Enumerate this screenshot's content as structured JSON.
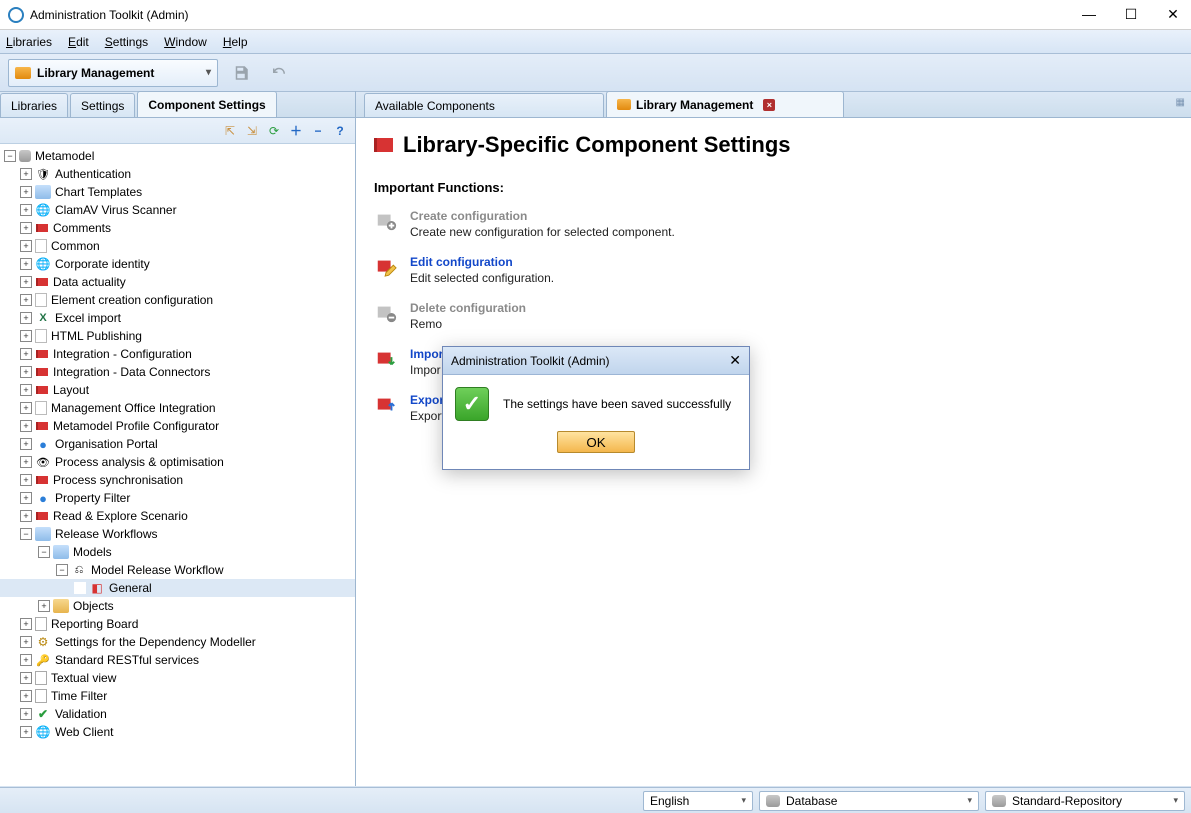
{
  "window": {
    "title": "Administration Toolkit (Admin)"
  },
  "menubar": {
    "items": [
      "Libraries",
      "Edit",
      "Settings",
      "Window",
      "Help"
    ]
  },
  "toolbar": {
    "library_dropdown": "Library Management"
  },
  "left_tabs": {
    "items": [
      "Libraries",
      "Settings",
      "Component Settings"
    ],
    "active_index": 2
  },
  "right_tabs": {
    "items": [
      {
        "label": "Available Components",
        "closable": false,
        "icon": false
      },
      {
        "label": "Library Management",
        "closable": true,
        "icon": true
      }
    ]
  },
  "tree": {
    "root": "Metamodel",
    "items": [
      {
        "label": "Authentication",
        "icon": "shield",
        "expand": "+"
      },
      {
        "label": "Chart Templates",
        "icon": "folder-open",
        "expand": "+"
      },
      {
        "label": "ClamAV Virus Scanner",
        "icon": "globe",
        "expand": "+"
      },
      {
        "label": "Comments",
        "icon": "flag",
        "expand": "+"
      },
      {
        "label": "Common",
        "icon": "page",
        "expand": "+"
      },
      {
        "label": "Corporate identity",
        "icon": "globe",
        "expand": "+"
      },
      {
        "label": "Data actuality",
        "icon": "flag",
        "expand": "+"
      },
      {
        "label": "Element creation configuration",
        "icon": "page",
        "expand": "+"
      },
      {
        "label": "Excel import",
        "icon": "excel",
        "expand": "+"
      },
      {
        "label": "HTML Publishing",
        "icon": "page",
        "expand": "+"
      },
      {
        "label": "Integration - Configuration",
        "icon": "flag",
        "expand": "+"
      },
      {
        "label": "Integration - Data Connectors",
        "icon": "flag",
        "expand": "+"
      },
      {
        "label": "Layout",
        "icon": "flag",
        "expand": "+"
      },
      {
        "label": "Management Office Integration",
        "icon": "page",
        "expand": "+"
      },
      {
        "label": "Metamodel Profile Configurator",
        "icon": "flag",
        "expand": "+"
      },
      {
        "label": "Organisation Portal",
        "icon": "bluedot",
        "expand": "+"
      },
      {
        "label": "Process analysis & optimisation",
        "icon": "eye",
        "expand": "+"
      },
      {
        "label": "Process synchronisation",
        "icon": "flag",
        "expand": "+"
      },
      {
        "label": "Property Filter",
        "icon": "bluedot",
        "expand": "+"
      },
      {
        "label": "Read & Explore Scenario",
        "icon": "flag",
        "expand": "+"
      }
    ],
    "release_workflows": {
      "label": "Release Workflows",
      "models": "Models",
      "model_release_workflow": "Model Release Workflow",
      "general": "General",
      "objects": "Objects"
    },
    "items_after": [
      {
        "label": "Reporting Board",
        "icon": "doc",
        "expand": "+"
      },
      {
        "label": "Settings for the Dependency Modeller",
        "icon": "gear",
        "expand": "+"
      },
      {
        "label": "Standard RESTful services",
        "icon": "key",
        "expand": "+"
      },
      {
        "label": "Textual view",
        "icon": "doc",
        "expand": "+"
      },
      {
        "label": "Time Filter",
        "icon": "doc",
        "expand": "+"
      },
      {
        "label": "Validation",
        "icon": "check",
        "expand": "+"
      },
      {
        "label": "Web Client",
        "icon": "globe",
        "expand": "+"
      }
    ]
  },
  "page": {
    "title": "Library-Specific Component Settings",
    "section": "Important Functions:",
    "functions": [
      {
        "key": "create",
        "title": "Create configuration",
        "desc": "Create new configuration for selected component.",
        "link": false
      },
      {
        "key": "edit",
        "title": "Edit configuration",
        "desc": "Edit selected configuration.",
        "link": true
      },
      {
        "key": "delete",
        "title": "Delete configuration",
        "desc": "Remo",
        "link": false
      },
      {
        "key": "import",
        "title": "Impor",
        "desc": "Impor",
        "link": true
      },
      {
        "key": "export",
        "title": "Expor",
        "desc": "Export settings of selected components.",
        "link": true
      }
    ]
  },
  "dialog": {
    "title": "Administration Toolkit (Admin)",
    "message": "The settings have been saved successfully",
    "ok": "OK"
  },
  "statusbar": {
    "language": "English",
    "database": "Database",
    "repository": "Standard-Repository"
  }
}
